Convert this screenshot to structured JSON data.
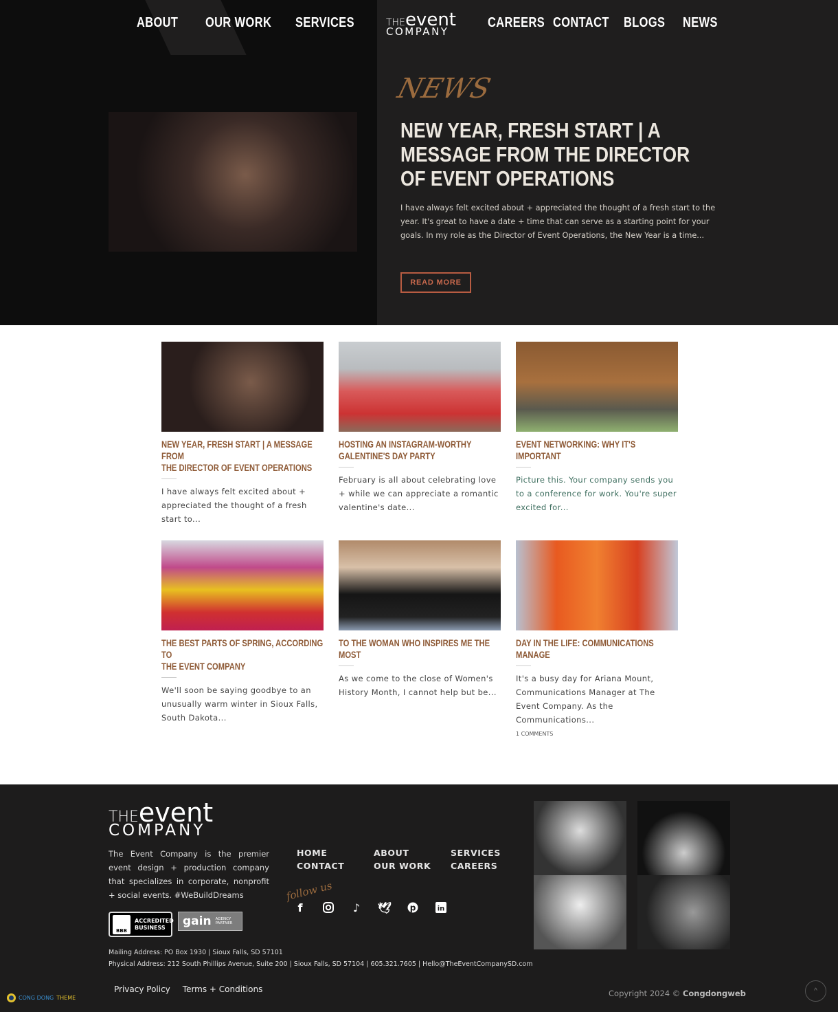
{
  "nav": {
    "items": [
      "ABOUT",
      "OUR WORK",
      "SERVICES",
      "CAREERS",
      "CONTACT",
      "BLOGS",
      "NEWS"
    ],
    "logo": {
      "the": "THE",
      "event": "event",
      "company": "COMPANY"
    }
  },
  "hero": {
    "section_label": "NEWS",
    "title": "NEW YEAR, FRESH START | A MESSAGE FROM THE DIRECTOR OF EVENT OPERATIONS",
    "excerpt": "I have always felt excited about + appreciated the thought of a fresh start to the year. It's great to have a date + time that can serve as a starting point for your goals. In my role as the Director of Event Operations, the New Year is a time...",
    "button": "READ MORE"
  },
  "posts": [
    {
      "title": "NEW YEAR, FRESH START | A MESSAGE FROM\nTHE DIRECTOR OF EVENT OPERATIONS",
      "excerpt": "I have always felt excited about + appreciated the thought of a fresh start to..."
    },
    {
      "title": "HOSTING AN INSTAGRAM-WORTHY\nGALENTINE'S DAY PARTY",
      "excerpt": "February is all about celebrating love + while we can appreciate a romantic valentine's date..."
    },
    {
      "title": "EVENT NETWORKING: WHY IT'S IMPORTANT",
      "excerpt": "Picture this. Your company sends you to a conference for work. You're super excited for..."
    },
    {
      "title": "THE BEST PARTS OF SPRING, ACCORDING TO\nTHE EVENT COMPANY",
      "excerpt": "We'll soon be saying goodbye to an unusually warm winter in Sioux Falls, South Dakota..."
    },
    {
      "title": "TO THE WOMAN WHO INSPIRES ME THE MOST",
      "excerpt": "As we come to the close of Women's History Month, I cannot help but be..."
    },
    {
      "title": "DAY IN THE LIFE: COMMUNICATIONS MANAGE",
      "excerpt": "It's a busy day for Ariana Mount, Communications Manager at The Event Company. As the Communications...",
      "comments": "1 COMMENTS"
    }
  ],
  "footer": {
    "logo": {
      "the": "THE",
      "event": "event",
      "company": "COMPANY"
    },
    "description": "The Event Company is the premier event design + production company that specializes in corporate, nonprofit + social events. #WeBuildDreams",
    "links": [
      "HOME",
      "ABOUT",
      "SERVICES",
      "CONTACT",
      "OUR WORK",
      "CAREERS"
    ],
    "follow": "follow us",
    "social_icons": [
      "facebook-icon",
      "instagram-icon",
      "tiktok-icon",
      "twitter-icon",
      "pinterest-icon",
      "linkedin-icon"
    ],
    "bbb": {
      "line1": "ACCREDITED",
      "line2": "BUSINESS",
      "mark": "BBB"
    },
    "gain": {
      "word": "gain",
      "line1": "AGENCY",
      "line2": "PARTNER"
    },
    "mailing": "Mailing Address: PO Box 1930 | Sioux Falls, SD 57101",
    "physical": "Physical Address: 212 South Phillips Avenue, Suite 200 | Sioux Falls, SD 57104 | 605.321.7605 | Hello@TheEventCompanySD.com",
    "legal": [
      "Privacy Policy",
      "Terms + Conditions"
    ],
    "copyright": "Copyright 2024 © ",
    "copyright_owner": "Congdongweb",
    "brand": {
      "a": "CONG DONG ",
      "b": "THEME"
    }
  },
  "colors": {
    "accent": "#9b6b3e",
    "card_title": "#8e5a36",
    "button": "#b85c42",
    "dark": "#1f1e1e"
  }
}
